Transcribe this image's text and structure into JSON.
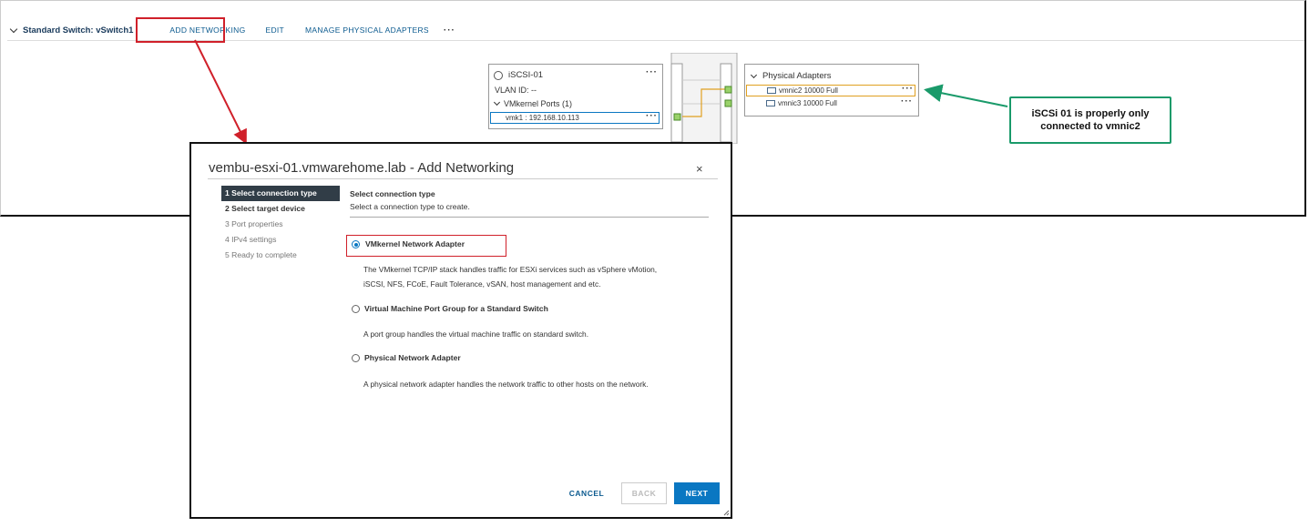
{
  "switch_bar": {
    "title": "Standard Switch: vSwitch1",
    "add_networking": "ADD NETWORKING",
    "edit": "EDIT",
    "manage_adapters": "MANAGE PHYSICAL ADAPTERS",
    "more": "···"
  },
  "port_group": {
    "name": "iSCSI-01",
    "vlan": "VLAN ID: --",
    "vmkernel_ports": "VMkernel Ports (1)",
    "vmk_entry": "vmk1 : 192.168.10.113",
    "more": "···"
  },
  "physical_adapters": {
    "title": "Physical Adapters",
    "adapters": [
      {
        "label": "vmnic2 10000 Full",
        "more": "···"
      },
      {
        "label": "vmnic3 10000 Full",
        "more": "···"
      }
    ]
  },
  "callout": {
    "line1": "iSCSi 01 is properly  only",
    "line2": "connected to vmnic2"
  },
  "colors": {
    "annotation_red": "#d0202a",
    "annotation_green": "#1a9a6a",
    "link_blue": "#0b5a8f",
    "primary_blue": "#0a77c2"
  },
  "dialog": {
    "title": "vembu-esxi-01.vmwarehome.lab - Add Networking",
    "close": "×",
    "steps": [
      "1 Select connection type",
      "2 Select target device",
      "3 Port properties",
      "4 IPv4 settings",
      "5 Ready to complete"
    ],
    "heading": "Select connection type",
    "subheading": "Select a connection type to create.",
    "options": [
      {
        "label": "VMkernel Network Adapter",
        "desc1": "The VMkernel TCP/IP stack handles traffic for ESXi services such as vSphere vMotion,",
        "desc2": "iSCSI, NFS, FCoE, Fault Tolerance, vSAN, host management and etc."
      },
      {
        "label": "Virtual Machine Port Group for a Standard Switch",
        "desc1": "A port group handles the virtual machine traffic on standard switch."
      },
      {
        "label": "Physical Network Adapter",
        "desc1": "A physical network adapter handles the network traffic to other hosts on the network."
      }
    ],
    "selected_option": "VMkernel Network Adapter",
    "cancel": "CANCEL",
    "back": "BACK",
    "next": "NEXT"
  }
}
